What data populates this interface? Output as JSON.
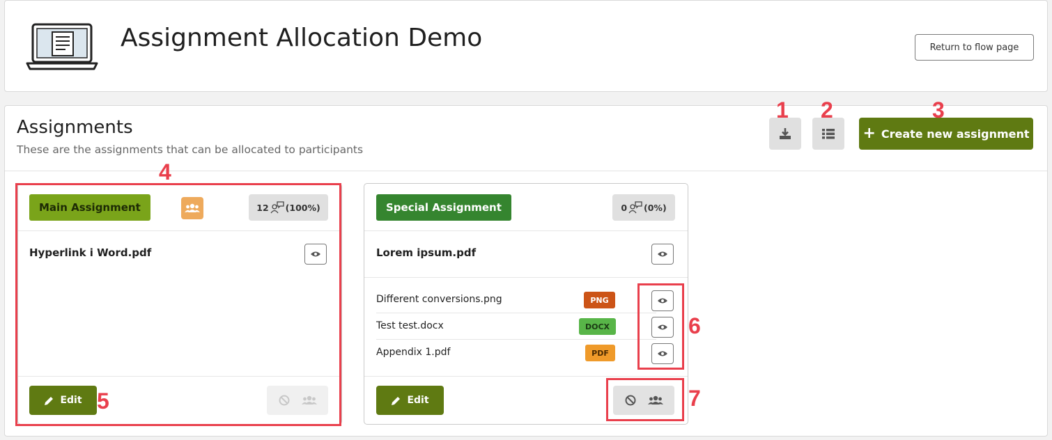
{
  "header": {
    "title": "Assignment Allocation Demo",
    "return_label": "Return to flow page",
    "icon": "laptop-document-icon"
  },
  "assignments_section": {
    "title": "Assignments",
    "subtitle": "These are the assignments that can be allocated to participants",
    "toolbar": {
      "download_icon": "download-icon",
      "list_icon": "list-icon",
      "create_label": "Create new assignment"
    }
  },
  "cards": [
    {
      "tag": "Main Assignment",
      "tag_color": "#7aa41a",
      "group_badge_icon": "users-icon",
      "count": "12",
      "count_pct": "(100%)",
      "main_file": "Hyperlink i Word.pdf",
      "attachments": [],
      "edit_label": "Edit"
    },
    {
      "tag": "Special Assignment",
      "tag_color": "#35852f",
      "count": "0",
      "count_pct": "(0%)",
      "main_file": "Lorem ipsum.pdf",
      "attachments": [
        {
          "name": "Different conversions.png",
          "ext": "PNG",
          "color": "#cc5417"
        },
        {
          "name": "Test test.docx",
          "ext": "DOCX",
          "color": "#58b548"
        },
        {
          "name": "Appendix 1.pdf",
          "ext": "PDF",
          "color": "#ef9a2a"
        }
      ],
      "edit_label": "Edit"
    }
  ],
  "annotations": {
    "n1": "1",
    "n2": "2",
    "n3": "3",
    "n4": "4",
    "n5": "5",
    "n6": "6",
    "n7": "7",
    "color": "#e93f4c"
  }
}
